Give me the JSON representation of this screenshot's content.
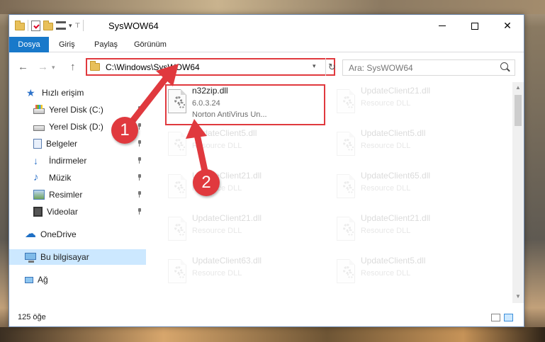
{
  "window": {
    "title": "SysWOW64",
    "controls": {
      "minimize": "",
      "maximize": "",
      "close": "✕"
    }
  },
  "ribbon": {
    "tabs": [
      "Dosya",
      "Giriş",
      "Paylaş",
      "Görünüm"
    ]
  },
  "address": {
    "path": "C:\\Windows\\SysWOW64",
    "refresh": "↻"
  },
  "search": {
    "placeholder": "Ara: SysWOW64"
  },
  "sidebar": {
    "items": [
      {
        "label": "Hızlı erişim"
      },
      {
        "label": "Yerel Disk (C:)"
      },
      {
        "label": "Yerel Disk (D:)"
      },
      {
        "label": "Belgeler"
      },
      {
        "label": "İndirmeler"
      },
      {
        "label": "Müzik"
      },
      {
        "label": "Resimler"
      },
      {
        "label": "Videolar"
      },
      {
        "label": "OneDrive"
      },
      {
        "label": "Bu bilgisayar"
      },
      {
        "label": "Ağ"
      }
    ]
  },
  "files": [
    {
      "name": "n32zip.dll",
      "version": "6.0.3.24",
      "company": "Norton AntiVirus Un..."
    },
    {
      "name": "UpdateClient21.dll",
      "desc": "Resource DLL"
    },
    {
      "name": "UpdateClient5.dll",
      "desc": "Resource DLL"
    },
    {
      "name": "UpdateClient5.dll",
      "desc": "Resource DLL"
    },
    {
      "name": "UpdateClient21.dll",
      "desc": "Resource DLL"
    },
    {
      "name": "UpdateClient65.dll",
      "desc": "Resource DLL"
    },
    {
      "name": "UpdateClient21.dll",
      "desc": "Resource DLL"
    },
    {
      "name": "UpdateClient21.dll",
      "desc": "Resource DLL"
    },
    {
      "name": "UpdateClient63.dll",
      "desc": "Resource DLL"
    },
    {
      "name": "UpdateClient5.dll",
      "desc": "Resource DLL"
    }
  ],
  "status": {
    "item_count": "125 öğe"
  },
  "annotations": {
    "step1": "1",
    "step2": "2",
    "color": "#e0393e"
  }
}
